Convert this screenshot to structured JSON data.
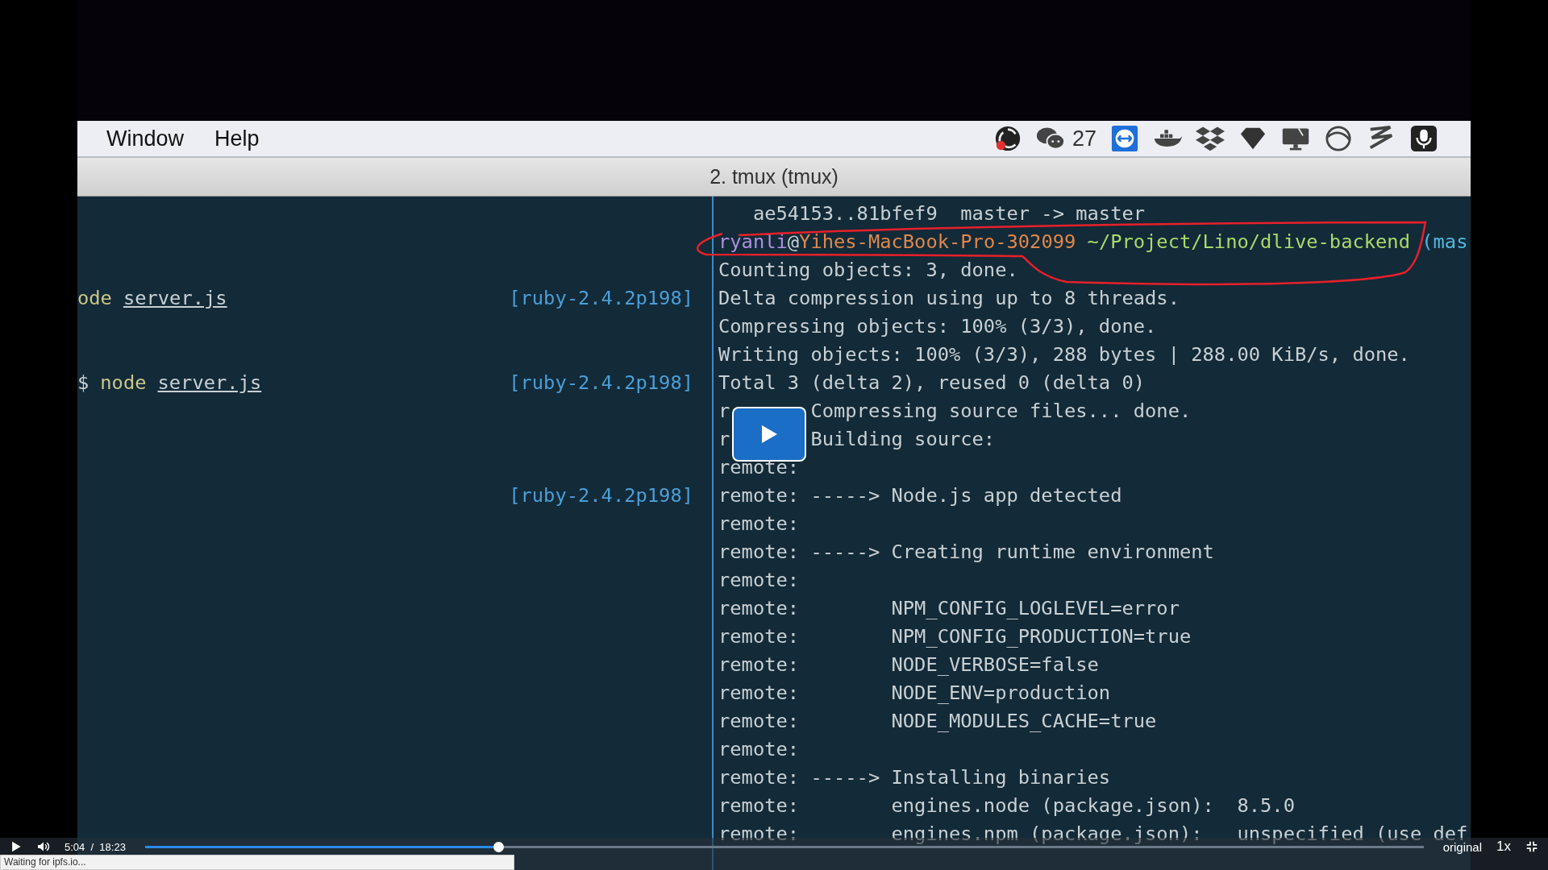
{
  "menu_bar": {
    "menus": [
      "Window",
      "Help"
    ],
    "chat_count": "27"
  },
  "window": {
    "title": "2. tmux (tmux)"
  },
  "left_pane": {
    "lines": [
      {
        "segments": [
          {
            "kind": "command",
            "text": "ode"
          },
          {
            "kind": "path",
            "text": "server.js"
          }
        ],
        "ruby": "[ruby-2.4.2p198]"
      },
      {
        "segments": [
          {
            "kind": "plain",
            "text": "$"
          },
          {
            "kind": "command",
            "text": "node"
          },
          {
            "kind": "path",
            "text": "server.js"
          }
        ],
        "ruby": "[ruby-2.4.2p198]"
      },
      {
        "ruby": "[ruby-2.4.2p198]"
      }
    ]
  },
  "right_pane": {
    "lines": [
      {
        "text": "   ae54153..81bfef9  master -> master"
      },
      {
        "segments": [
          {
            "text": "ryanli",
            "color": "#b08fe0"
          },
          {
            "text": "@",
            "color": "#c8d0d4"
          },
          {
            "text": "Yihes-MacBook-Pro-302099",
            "color": "#e0884a"
          },
          {
            "text": " ~/Project/Lino/dlive-backend",
            "color": "#a8dc6a"
          },
          {
            "text": " (mas",
            "color": "#4fb8e0"
          }
        ]
      },
      {
        "text": "Counting objects: 3, done."
      },
      {
        "text": "Delta compression using up to 8 threads."
      },
      {
        "text": "Compressing objects: 100% (3/3), done."
      },
      {
        "text": "Writing objects: 100% (3/3), 288 bytes | 288.00 KiB/s, done."
      },
      {
        "text": "Total 3 (delta 2), reused 0 (delta 0)"
      },
      {
        "head": "r",
        "text": "Compressing source files... done."
      },
      {
        "head": "r",
        "text": "Building source:"
      },
      {
        "text": "remote:"
      },
      {
        "text": "remote: -----> Node.js app detected"
      },
      {
        "text": "remote:"
      },
      {
        "text": "remote: -----> Creating runtime environment"
      },
      {
        "text": "remote:"
      },
      {
        "text": "remote:        NPM_CONFIG_LOGLEVEL=error"
      },
      {
        "text": "remote:        NPM_CONFIG_PRODUCTION=true"
      },
      {
        "text": "remote:        NODE_VERBOSE=false"
      },
      {
        "text": "remote:        NODE_ENV=production"
      },
      {
        "text": "remote:        NODE_MODULES_CACHE=true"
      },
      {
        "text": "remote:"
      },
      {
        "text": "remote: -----> Installing binaries"
      },
      {
        "text": "remote:        engines.node (package.json):  8.5.0"
      },
      {
        "text": "remote:        engines.npm (package.json):   unspecified (use def"
      }
    ]
  },
  "player": {
    "playing": false,
    "time": "5:04  /  18:23",
    "progress": {
      "level": 0.276
    },
    "quality": "original",
    "speed": "1x",
    "status": "Waiting for ipfs.io..."
  }
}
